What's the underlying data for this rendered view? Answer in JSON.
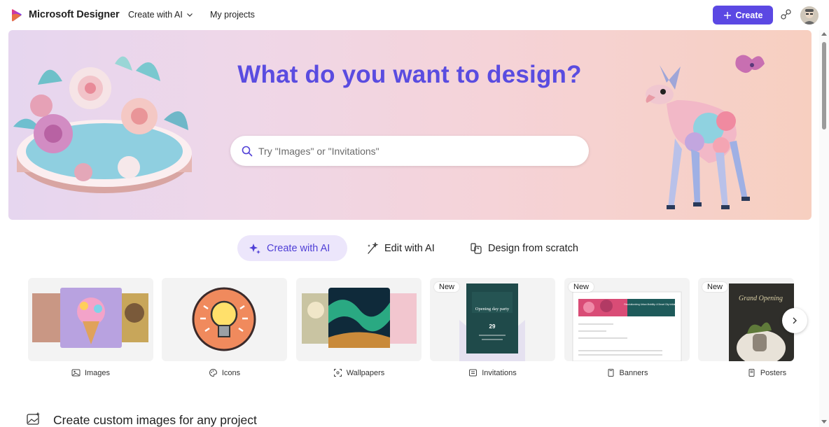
{
  "header": {
    "brand": "Microsoft Designer",
    "nav_create_ai": "Create with AI",
    "nav_projects": "My projects",
    "create_button": "Create",
    "colors": {
      "accent": "#5b48e3"
    }
  },
  "hero": {
    "title": "What do you want to design?",
    "search_placeholder": "Try \"Images\" or \"Invitations\"",
    "title_color": "#5a4ce0"
  },
  "tabs": [
    {
      "label": "Create with AI",
      "icon": "sparkle-icon",
      "active": true
    },
    {
      "label": "Edit with AI",
      "icon": "magic-wand-icon",
      "active": false
    },
    {
      "label": "Design from scratch",
      "icon": "design-shapes-icon",
      "active": false
    }
  ],
  "categories": [
    {
      "label": "Images",
      "icon": "image-icon",
      "badge": ""
    },
    {
      "label": "Icons",
      "icon": "palette-icon",
      "badge": ""
    },
    {
      "label": "Wallpapers",
      "icon": "wallpaper-icon",
      "badge": ""
    },
    {
      "label": "Invitations",
      "icon": "invitation-icon",
      "badge": "New"
    },
    {
      "label": "Banners",
      "icon": "banner-icon",
      "badge": "New"
    },
    {
      "label": "Posters",
      "icon": "poster-icon",
      "badge": "New"
    }
  ],
  "card_text": {
    "invitation_title": "Opening day party",
    "invitation_date": "29",
    "banner_title": "Revolutionizing Urban Mobility: A Smart City Initiative",
    "poster_title": "Grand Opening"
  },
  "section": {
    "title": "Create custom images for any project",
    "icon": "image-sparkle-icon"
  }
}
